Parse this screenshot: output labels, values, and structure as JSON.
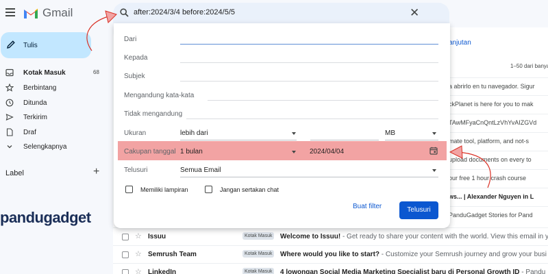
{
  "header": {
    "app_name": "Gmail",
    "search_query": "after:2024/3/4 before:2024/5/5"
  },
  "sidebar": {
    "compose_label": "Tulis",
    "items": [
      {
        "label": "Kotak Masuk",
        "count": "68",
        "icon": "inbox-icon"
      },
      {
        "label": "Berbintang",
        "count": "",
        "icon": "star-icon"
      },
      {
        "label": "Ditunda",
        "count": "",
        "icon": "clock-icon"
      },
      {
        "label": "Terkirim",
        "count": "",
        "icon": "send-icon"
      },
      {
        "label": "Draf",
        "count": "",
        "icon": "draft-icon"
      },
      {
        "label": "Selengkapnya",
        "count": "",
        "icon": "chevron-down-icon"
      }
    ],
    "labels_heading": "Label",
    "add_label": "+"
  },
  "watermark": "pandugadget",
  "search_panel": {
    "from_label": "Dari",
    "to_label": "Kepada",
    "subject_label": "Subjek",
    "has_words_label": "Mengandung kata-kata",
    "not_has_label": "Tidak mengandung",
    "size_label": "Ukuran",
    "size_op": "lebih dari",
    "size_unit": "MB",
    "date_range_label": "Cakupan tanggal",
    "date_range_value": "1 bulan",
    "date_value": "2024/04/04",
    "search_in_label": "Telusuri",
    "search_in_value": "Semua Email",
    "has_attachment_label": "Memiliki lampiran",
    "exclude_chats_label": "Jangan sertakan chat",
    "create_filter_label": "Buat filter",
    "search_button_label": "Telusuri"
  },
  "background": {
    "advanced_link": "anjutan",
    "page_count": "1–50 dari banya",
    "snippets": [
      {
        "text": "a abrirlo en tu navegador. Sigur",
        "bold": false
      },
      {
        "text": "ckPlanet is here for you to mak",
        "bold": false
      },
      {
        "text": "TAwMFyaCnQntLzVhYvAIZGVd",
        "bold": false
      },
      {
        "text": "mate tool, platform, and not-s",
        "bold": false
      },
      {
        "text": "upload documents on every to",
        "bold": false
      },
      {
        "text": "our free 1 hour crash course",
        "bold": false
      },
      {
        "text": "ws... | Alexander Nguyen in L",
        "bold": true
      },
      {
        "text": "PanduGadget Stories for Pand",
        "bold": false
      }
    ],
    "rows": [
      {
        "sender": "Issuu",
        "tag": "Kotak Masuk",
        "subject": "Welcome to Issuu!",
        "snippet": " - Get ready to share your content with the world. View this email in y"
      },
      {
        "sender": "Semrush Team",
        "tag": "Kotak Masuk",
        "subject": "Where would you like to start?",
        "snippet": " - Customize your Semrush journey and grow your busi"
      },
      {
        "sender": "LinkedIn",
        "tag": "Kotak Masuk",
        "subject": "4 lowongan Social Media Marketing Specialist baru di Personal Growth ID",
        "snippet": " - Pandu"
      }
    ]
  },
  "colors": {
    "accent": "#0b57d0",
    "compose_bg": "#c2e7ff",
    "highlight": "#f2a3a3",
    "annotation": "#d93025"
  }
}
